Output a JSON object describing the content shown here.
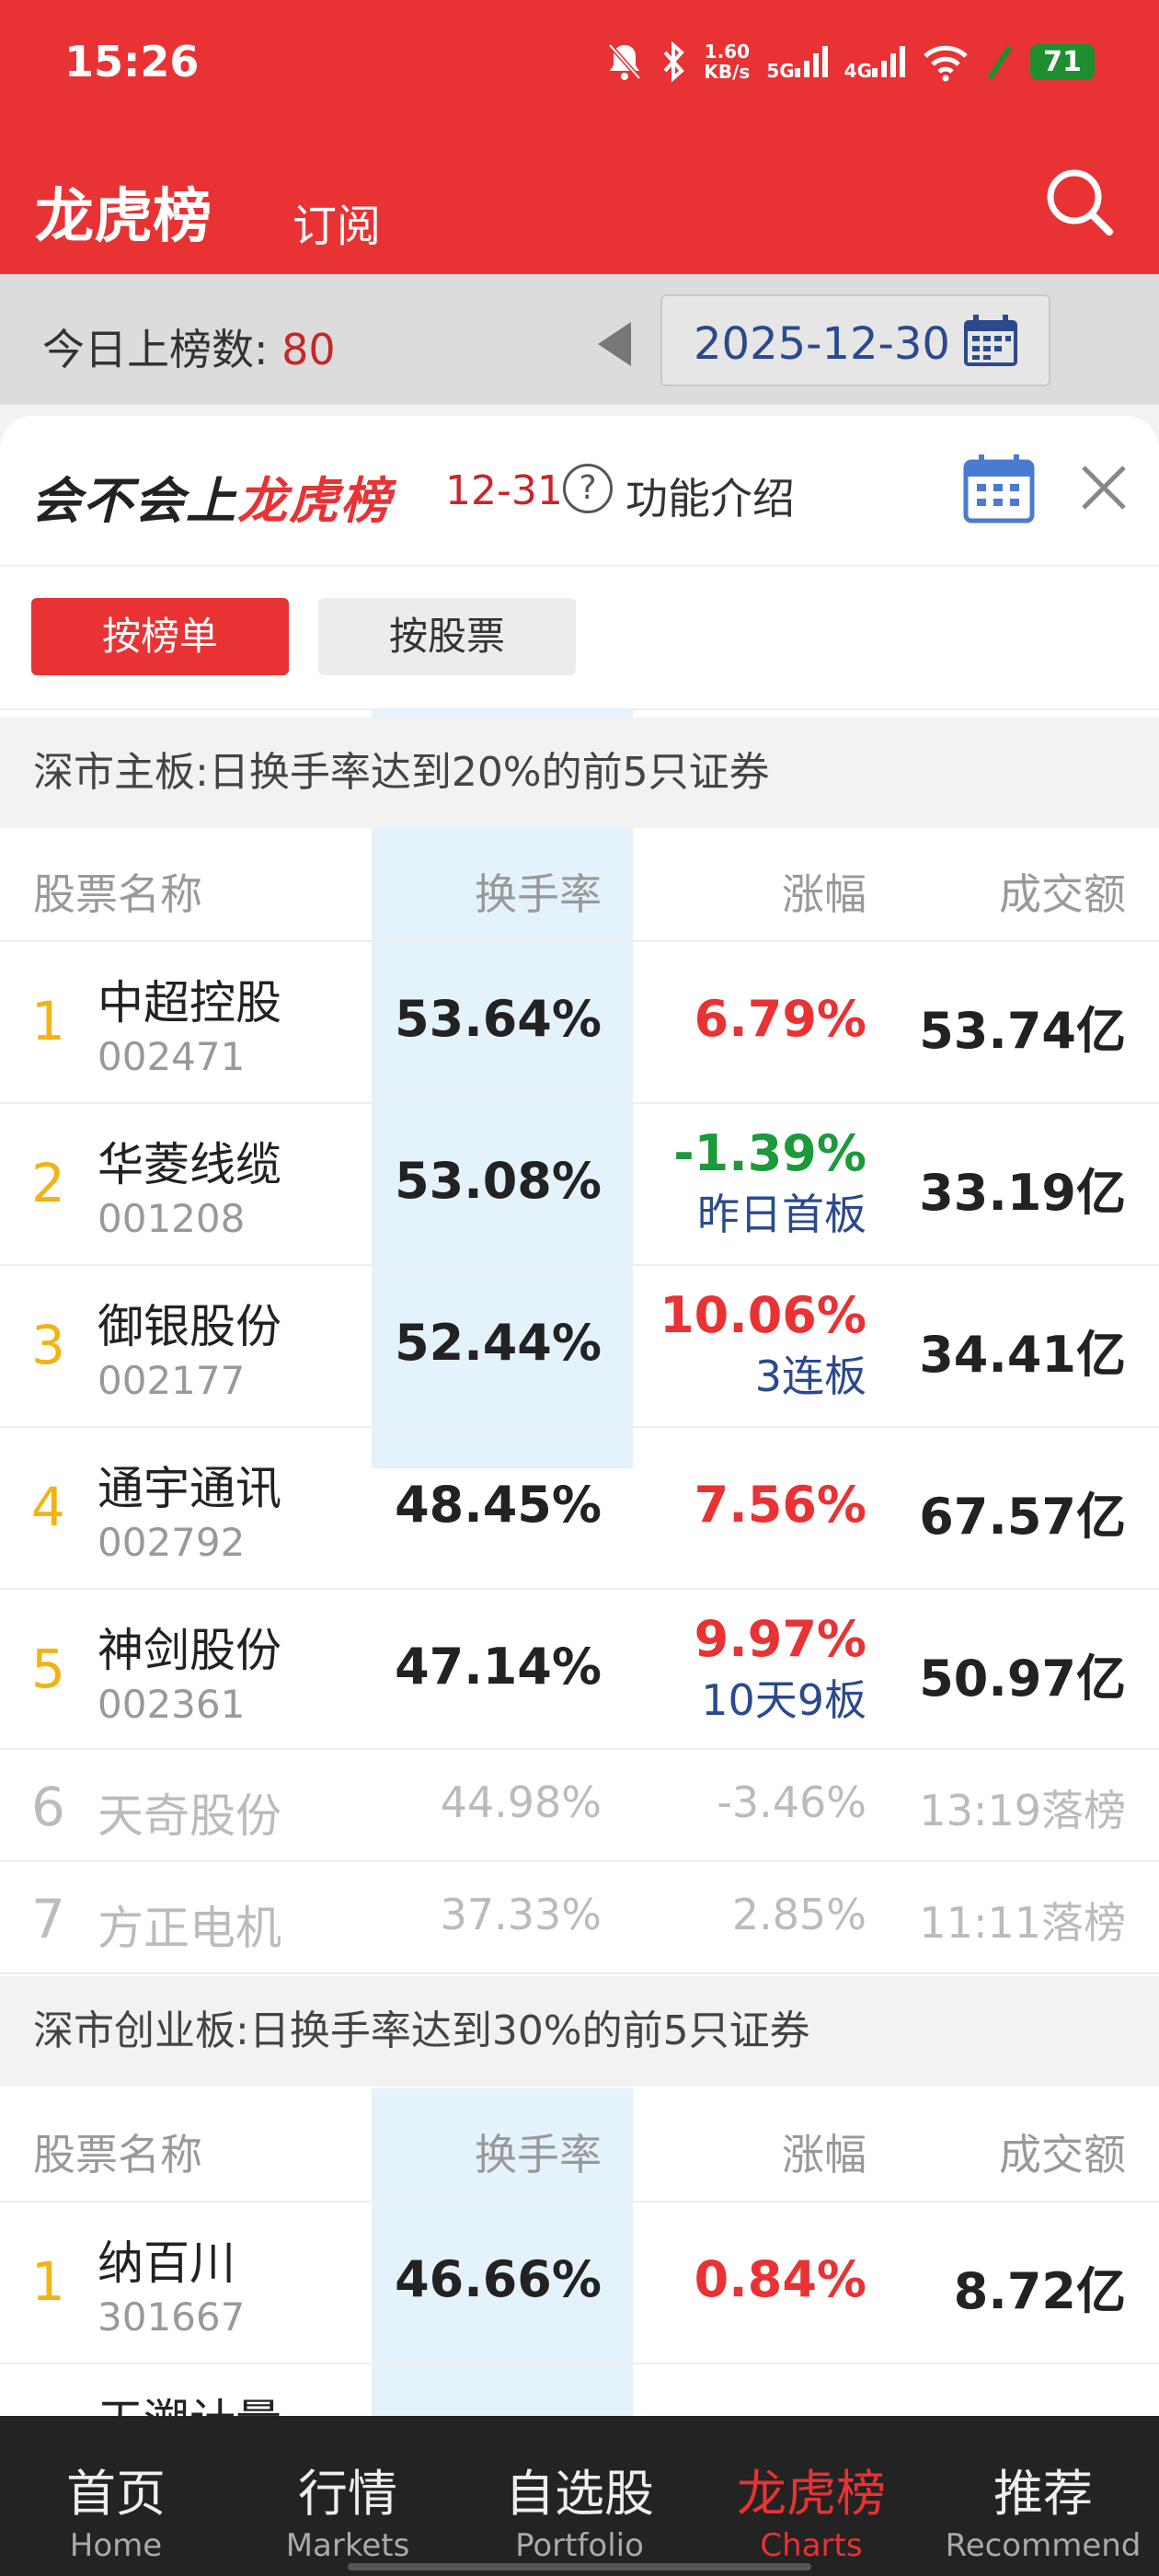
{
  "status": {
    "time": "15:26",
    "net_speed_top": "1.60",
    "net_speed_unit": "KB/s",
    "net1": "5G",
    "net2": "4G",
    "battery": "71"
  },
  "header": {
    "title": "龙虎榜",
    "subscribe": "订阅"
  },
  "countbar": {
    "label": "今日上榜数: ",
    "count": "80",
    "date": "2025-12-30"
  },
  "sheet": {
    "logo_a": "会不会上",
    "logo_b": "龙虎榜",
    "date": "12-31",
    "qmark": "?",
    "func_label": "功能介绍",
    "tabs": {
      "by_list": "按榜单",
      "by_stock": "按股票"
    }
  },
  "table_header": {
    "name": "股票名称",
    "turnover": "换手率",
    "change": "涨幅",
    "amount": "成交额"
  },
  "section1": {
    "title": "深市主板:日换手率达到20%的前5只证券",
    "rows": [
      {
        "rank": "1",
        "name": "中超控股",
        "code": "002471",
        "turnover": "53.64%",
        "change": "6.79%",
        "tag": "",
        "amount": "53.74亿"
      },
      {
        "rank": "2",
        "name": "华菱线缆",
        "code": "001208",
        "turnover": "53.08%",
        "change": "-1.39%",
        "tag": "昨日首板",
        "amount": "33.19亿"
      },
      {
        "rank": "3",
        "name": "御银股份",
        "code": "002177",
        "turnover": "52.44%",
        "change": "10.06%",
        "tag": "3连板",
        "amount": "34.41亿"
      },
      {
        "rank": "4",
        "name": "通宇通讯",
        "code": "002792",
        "turnover": "48.45%",
        "change": "7.56%",
        "tag": "",
        "amount": "67.57亿"
      },
      {
        "rank": "5",
        "name": "神剑股份",
        "code": "002361",
        "turnover": "47.14%",
        "change": "9.97%",
        "tag": "10天9板",
        "amount": "50.97亿"
      }
    ],
    "dropped": [
      {
        "rank": "6",
        "name": "天奇股份",
        "turnover": "44.98%",
        "change": "-3.46%",
        "amount": "13:19落榜"
      },
      {
        "rank": "7",
        "name": "方正电机",
        "turnover": "37.33%",
        "change": "2.85%",
        "amount": "11:11落榜"
      }
    ]
  },
  "section2": {
    "title": "深市创业板:日换手率达到30%的前5只证券",
    "rows": [
      {
        "rank": "1",
        "name": "纳百川",
        "code": "301667",
        "turnover": "46.66%",
        "change": "0.84%",
        "amount": "8.72亿"
      },
      {
        "rank": "2",
        "name": "天溯计量"
      }
    ]
  },
  "nav": [
    {
      "zh": "首页",
      "en": "Home"
    },
    {
      "zh": "行情",
      "en": "Markets"
    },
    {
      "zh": "自选股",
      "en": "Portfolio"
    },
    {
      "zh": "龙虎榜",
      "en": "Charts"
    },
    {
      "zh": "推荐",
      "en": "Recommend"
    }
  ],
  "colors": {
    "brand_red": "#e83234",
    "up": "#e83234",
    "down": "#1a9a3a",
    "tag_blue": "#2b4a8d",
    "rank_gold": "#f2b313"
  }
}
